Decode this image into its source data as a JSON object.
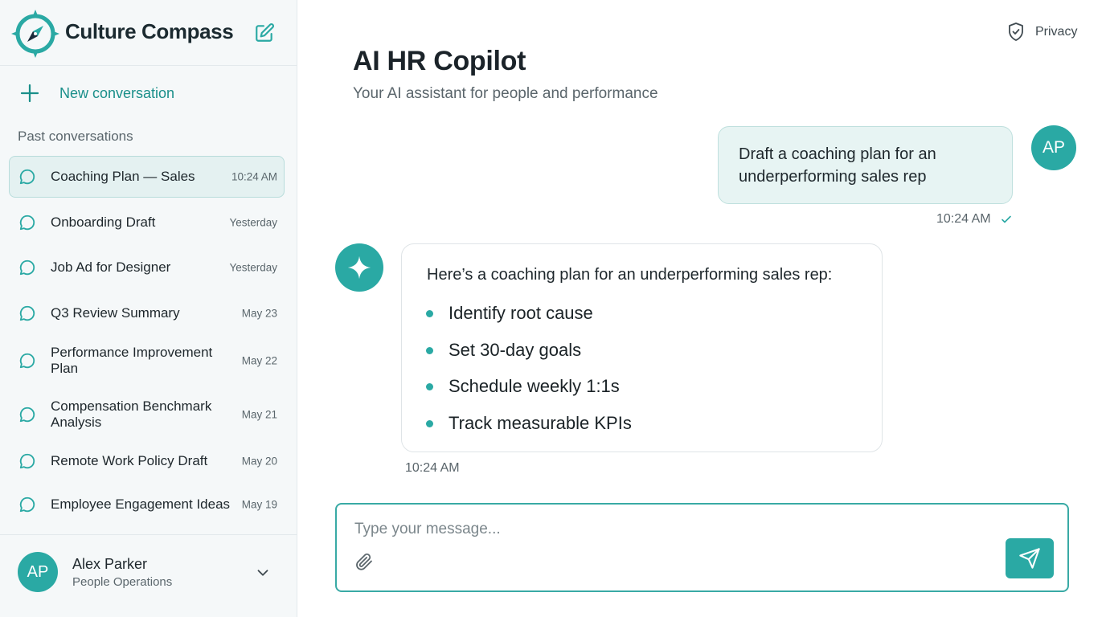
{
  "theme": {
    "accent": "#2aa9a4",
    "accent_dark": "#1a8f8a",
    "sidebar_bg": "#f5f8f9",
    "user_bubble_bg": "#e7f4f3"
  },
  "app": {
    "name": "Culture Compass",
    "logo_icon": "compass-icon",
    "compose_icon": "edit-icon"
  },
  "sidebar": {
    "new_conversation_label": "New conversation",
    "past_heading": "Past conversations",
    "conversations": [
      {
        "title": "Coaching Plan — Sales",
        "time": "10:24 AM",
        "active": true
      },
      {
        "title": "Onboarding Draft",
        "time": "Yesterday"
      },
      {
        "title": "Job Ad for Designer",
        "time": "Yesterday"
      },
      {
        "title": "Q3 Review Summary",
        "time": "May 23"
      },
      {
        "title": "Performance Improvement Plan",
        "time": "May 22"
      },
      {
        "title": "Compensation Benchmark Analysis",
        "time": "May 21"
      },
      {
        "title": "Remote Work Policy Draft",
        "time": "May 20"
      },
      {
        "title": "Employee Engagement Ideas",
        "time": "May 19"
      }
    ]
  },
  "user": {
    "initials": "AP",
    "name": "Alex Parker",
    "role": "People Operations"
  },
  "header": {
    "privacy_label": "Privacy",
    "title": "AI HR Copilot",
    "subtitle": "Your AI assistant for people and performance"
  },
  "messages": {
    "user_message": {
      "text": "Draft a coaching plan for an underperforming sales rep",
      "time": "10:24 AM",
      "avatar": "AP"
    },
    "assistant_message": {
      "intro": "Here’s a coaching plan for an underperforming sales rep:",
      "bullets": [
        "Identify root cause",
        "Set 30-day goals",
        "Schedule weekly 1:1s",
        "Track measurable KPIs"
      ],
      "time": "10:24 AM",
      "avatar_icon": "sparkle-icon"
    }
  },
  "composer": {
    "placeholder": "Type your message...",
    "value": "",
    "attach_icon": "paperclip-icon",
    "send_icon": "send-icon"
  }
}
